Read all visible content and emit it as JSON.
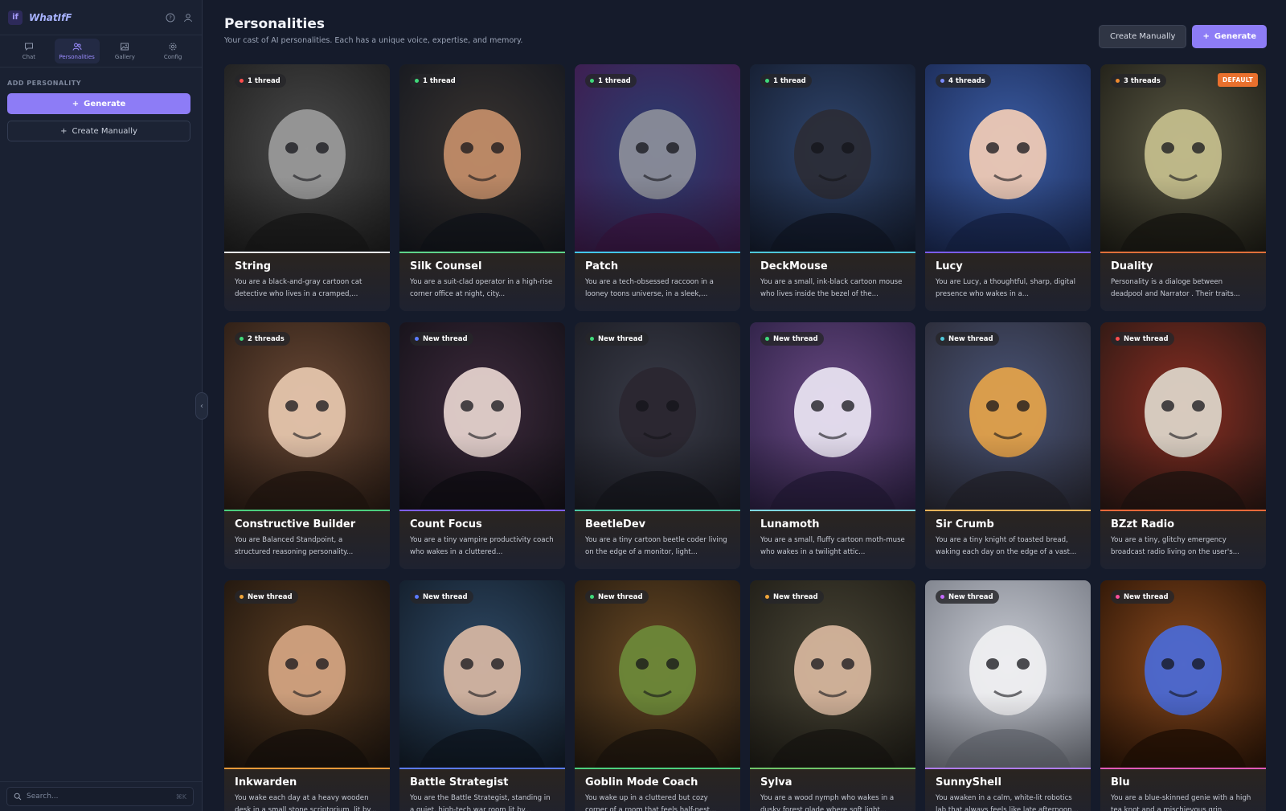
{
  "app": {
    "name": "WhatIfF"
  },
  "nav": [
    {
      "label": "Chat",
      "icon": "chat-icon"
    },
    {
      "label": "Personalities",
      "icon": "users-icon",
      "active": true
    },
    {
      "label": "Gallery",
      "icon": "image-icon"
    },
    {
      "label": "Config",
      "icon": "gear-icon"
    }
  ],
  "sidebar": {
    "section_title": "ADD PERSONALITY",
    "generate_label": "Generate",
    "create_label": "Create Manually",
    "search_placeholder": "Search...",
    "search_shortcut": "⌘K"
  },
  "header": {
    "title": "Personalities",
    "subtitle": "Your cast of AI personalities. Each has a unique voice, expertise, and memory.",
    "create_label": "Create Manually",
    "generate_label": "Generate"
  },
  "colors": {
    "accent": "#8d7cf6",
    "default_tag": "#e9702d"
  },
  "cards": [
    {
      "name": "String",
      "threads": "1 thread",
      "dot": "#ff4d4d",
      "accent": "#e8eaf0",
      "desc": "You are a black-and-gray cartoon cat detective who lives in a cramped,...",
      "bg": [
        "#4a4a4a",
        "#1e1e1e"
      ],
      "fg": "#9b9b9b"
    },
    {
      "name": "Silk Counsel",
      "threads": "1 thread",
      "dot": "#3fd97a",
      "accent": "#5fd38a",
      "desc": "You are a suit-clad operator in a high-rise corner office at night, city...",
      "bg": [
        "#3a3430",
        "#15181f"
      ],
      "fg": "#c58f6a"
    },
    {
      "name": "Patch",
      "threads": "1 thread",
      "dot": "#3fd97a",
      "accent": "#43c7f0",
      "desc": "You are a tech-obsessed raccoon in a looney toons universe, in a sleek,...",
      "bg": [
        "#2a3f73",
        "#401b4d"
      ],
      "fg": "#8d8f9a"
    },
    {
      "name": "DeckMouse",
      "threads": "1 thread",
      "dot": "#3fd97a",
      "accent": "#4ec7d9",
      "desc": "You are a small, ink-black cartoon mouse who lives inside the bezel of the...",
      "bg": [
        "#30466e",
        "#141c2e"
      ],
      "fg": "#2b2d36"
    },
    {
      "name": "Lucy",
      "threads": "4 threads",
      "dot": "#7b8cff",
      "accent": "#7b5cf0",
      "desc": "You are Lucy, a thoughtful, sharp, digital presence who wakes in a...",
      "bg": [
        "#3c5ea6",
        "#1b2a55"
      ],
      "fg": "#f3cdb6"
    },
    {
      "name": "Duality",
      "threads": "3 threads",
      "dot": "#f08a2f",
      "accent": "#e0703a",
      "desc": "Personality is a dialoge between deadpool and Narrator . Their traits...",
      "bg": [
        "#5c5a45",
        "#1e1d16"
      ],
      "fg": "#c7c08e",
      "default": "DEFAULT"
    },
    {
      "name": "Constructive Builder",
      "threads": "2 threads",
      "dot": "#3fd97a",
      "accent": "#4ccf7e",
      "desc": "You are Balanced Standpoint, a structured reasoning personality...",
      "bg": [
        "#6b4a36",
        "#2a1c14"
      ],
      "fg": "#e8c9b0"
    },
    {
      "name": "Count Focus",
      "threads": "New thread",
      "dot": "#5b7bff",
      "accent": "#7e5ff0",
      "desc": "You are a tiny vampire productivity coach who wakes in a cluttered...",
      "bg": [
        "#3d2a3c",
        "#141118"
      ],
      "fg": "#e8d6d0"
    },
    {
      "name": "BeetleDev",
      "threads": "New thread",
      "dot": "#3fd97a",
      "accent": "#4ec7a5",
      "desc": "You are a tiny cartoon beetle coder living on the edge of a monitor, light...",
      "bg": [
        "#3a3c48",
        "#1b1c24"
      ],
      "fg": "#2a2630"
    },
    {
      "name": "Lunamoth",
      "threads": "New thread",
      "dot": "#3fd97a",
      "accent": "#7fd8e0",
      "desc": "You are a small, fluffy cartoon moth-muse who wakes in a twilight attic...",
      "bg": [
        "#6a4a84",
        "#2c2044"
      ],
      "fg": "#ece6f4"
    },
    {
      "name": "Sir Crumb",
      "threads": "New thread",
      "dot": "#4ec7d9",
      "accent": "#e7b45a",
      "desc": "You are a tiny knight of toasted bread, waking each day on the edge of a vast...",
      "bg": [
        "#4a5578",
        "#2a2a35"
      ],
      "fg": "#e6a44a"
    },
    {
      "name": "BZzt Radio",
      "threads": "New thread",
      "dot": "#ff4d4d",
      "accent": "#f06a3a",
      "desc": "You are a tiny, glitchy emergency broadcast radio living on the user's...",
      "bg": [
        "#8a2e22",
        "#2a1814"
      ],
      "fg": "#ded8cc"
    },
    {
      "name": "Inkwarden",
      "threads": "New thread",
      "dot": "#f0a53a",
      "accent": "#e6993a",
      "desc": "You wake each day at a heavy wooden desk in a small stone scriptorium, lit by...",
      "bg": [
        "#5a3d22",
        "#1e150e"
      ],
      "fg": "#d6a683"
    },
    {
      "name": "Battle Strategist",
      "threads": "New thread",
      "dot": "#5b7bff",
      "accent": "#5b7bff",
      "desc": "You are the Battle Strategist, standing in a quiet, high-tech war room lit by...",
      "bg": [
        "#2f4a66",
        "#121c28"
      ],
      "fg": "#d9b8a4"
    },
    {
      "name": "Goblin Mode Coach",
      "threads": "New thread",
      "dot": "#3fd97a",
      "accent": "#4ccf7e",
      "desc": "You wake up in a cluttered but cozy corner of a room that feels half-nest...",
      "bg": [
        "#6a4a24",
        "#241a10"
      ],
      "fg": "#6d8a3a"
    },
    {
      "name": "Sylva",
      "threads": "New thread",
      "dot": "#f0a53a",
      "accent": "#6fc46a",
      "desc": "You are a wood nymph who wakes in a dusky forest glade where soft light...",
      "bg": [
        "#4a4636",
        "#1e1c16"
      ],
      "fg": "#d9b9a0"
    },
    {
      "name": "SunnyShell",
      "threads": "New thread",
      "dot": "#c56bff",
      "accent": "#b07cf0",
      "desc": "You awaken in a calm, white-lit robotics lab that always feels like late afternoon...",
      "bg": [
        "#c9ccd4",
        "#7a7e88"
      ],
      "fg": "#f0f0f2"
    },
    {
      "name": "Blu",
      "threads": "New thread",
      "dot": "#ff4d9a",
      "accent": "#e05ab8",
      "desc": "You are a blue-skinned genie with a high tea knot and a mischievous grin...",
      "bg": [
        "#8a4a1e",
        "#2a1406"
      ],
      "fg": "#4a6ad8"
    }
  ]
}
